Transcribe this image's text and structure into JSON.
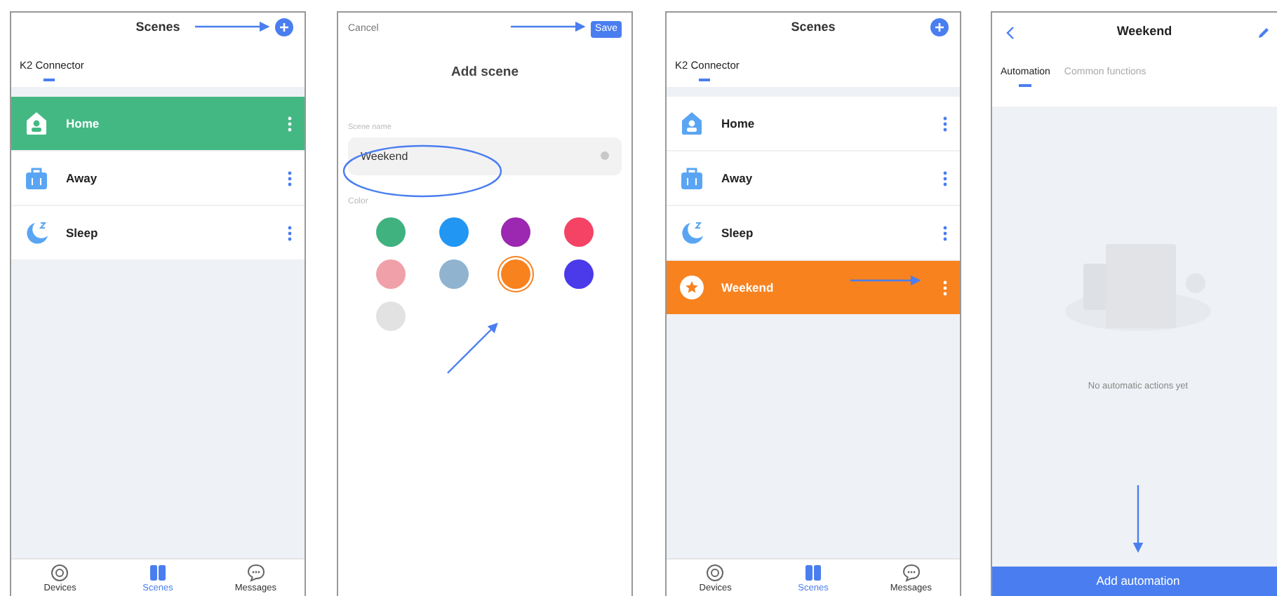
{
  "screens": [
    {
      "kind": "scene_list",
      "title": "Scenes",
      "tab": "K2 Connector",
      "scenes": [
        {
          "name": "Home",
          "kind": "home",
          "selected": true,
          "color": "#43b883"
        },
        {
          "name": "Away",
          "kind": "bag",
          "selected": false
        },
        {
          "name": "Sleep",
          "kind": "moon",
          "selected": false
        }
      ],
      "nav": [
        {
          "label": "Devices",
          "kind": "devices",
          "selected": false
        },
        {
          "label": "Scenes",
          "kind": "scenes",
          "selected": true
        },
        {
          "label": "Messages",
          "kind": "messages",
          "selected": false
        }
      ]
    },
    {
      "kind": "add_scene",
      "cancel": "Cancel",
      "save": "Save",
      "title": "Add scene",
      "field_label": "Scene name",
      "value": "Weekend",
      "color_label": "Color",
      "colors": [
        {
          "color": "#3fb27f",
          "selected": false
        },
        {
          "color": "#2196f3",
          "selected": false
        },
        {
          "color": "#9c27b0",
          "selected": false
        },
        {
          "color": "#f44365",
          "selected": false
        },
        {
          "color": "#f0a0a8",
          "selected": false
        },
        {
          "color": "#90b4d0",
          "selected": false
        },
        {
          "color": "#f7821e",
          "selected": true
        },
        {
          "color": "#4a3aea",
          "selected": false
        },
        {
          "color": "#e2e2e2",
          "selected": false
        }
      ]
    },
    {
      "kind": "scene_list",
      "title": "Scenes",
      "tab": "K2 Connector",
      "scenes": [
        {
          "name": "Home",
          "kind": "home",
          "selected": false
        },
        {
          "name": "Away",
          "kind": "bag",
          "selected": false
        },
        {
          "name": "Sleep",
          "kind": "moon",
          "selected": false
        },
        {
          "name": "Weekend",
          "kind": "star",
          "selected": true,
          "color": "#f7821e"
        }
      ],
      "nav": [
        {
          "label": "Devices",
          "kind": "devices",
          "selected": false
        },
        {
          "label": "Scenes",
          "kind": "scenes",
          "selected": true
        },
        {
          "label": "Messages",
          "kind": "messages",
          "selected": false
        }
      ]
    },
    {
      "kind": "scene_detail",
      "title": "Weekend",
      "tabs": [
        {
          "label": "Automation",
          "selected": true
        },
        {
          "label": "Common functions",
          "selected": false
        }
      ],
      "empty_text": "No automatic actions yet",
      "button": "Add automation"
    }
  ]
}
